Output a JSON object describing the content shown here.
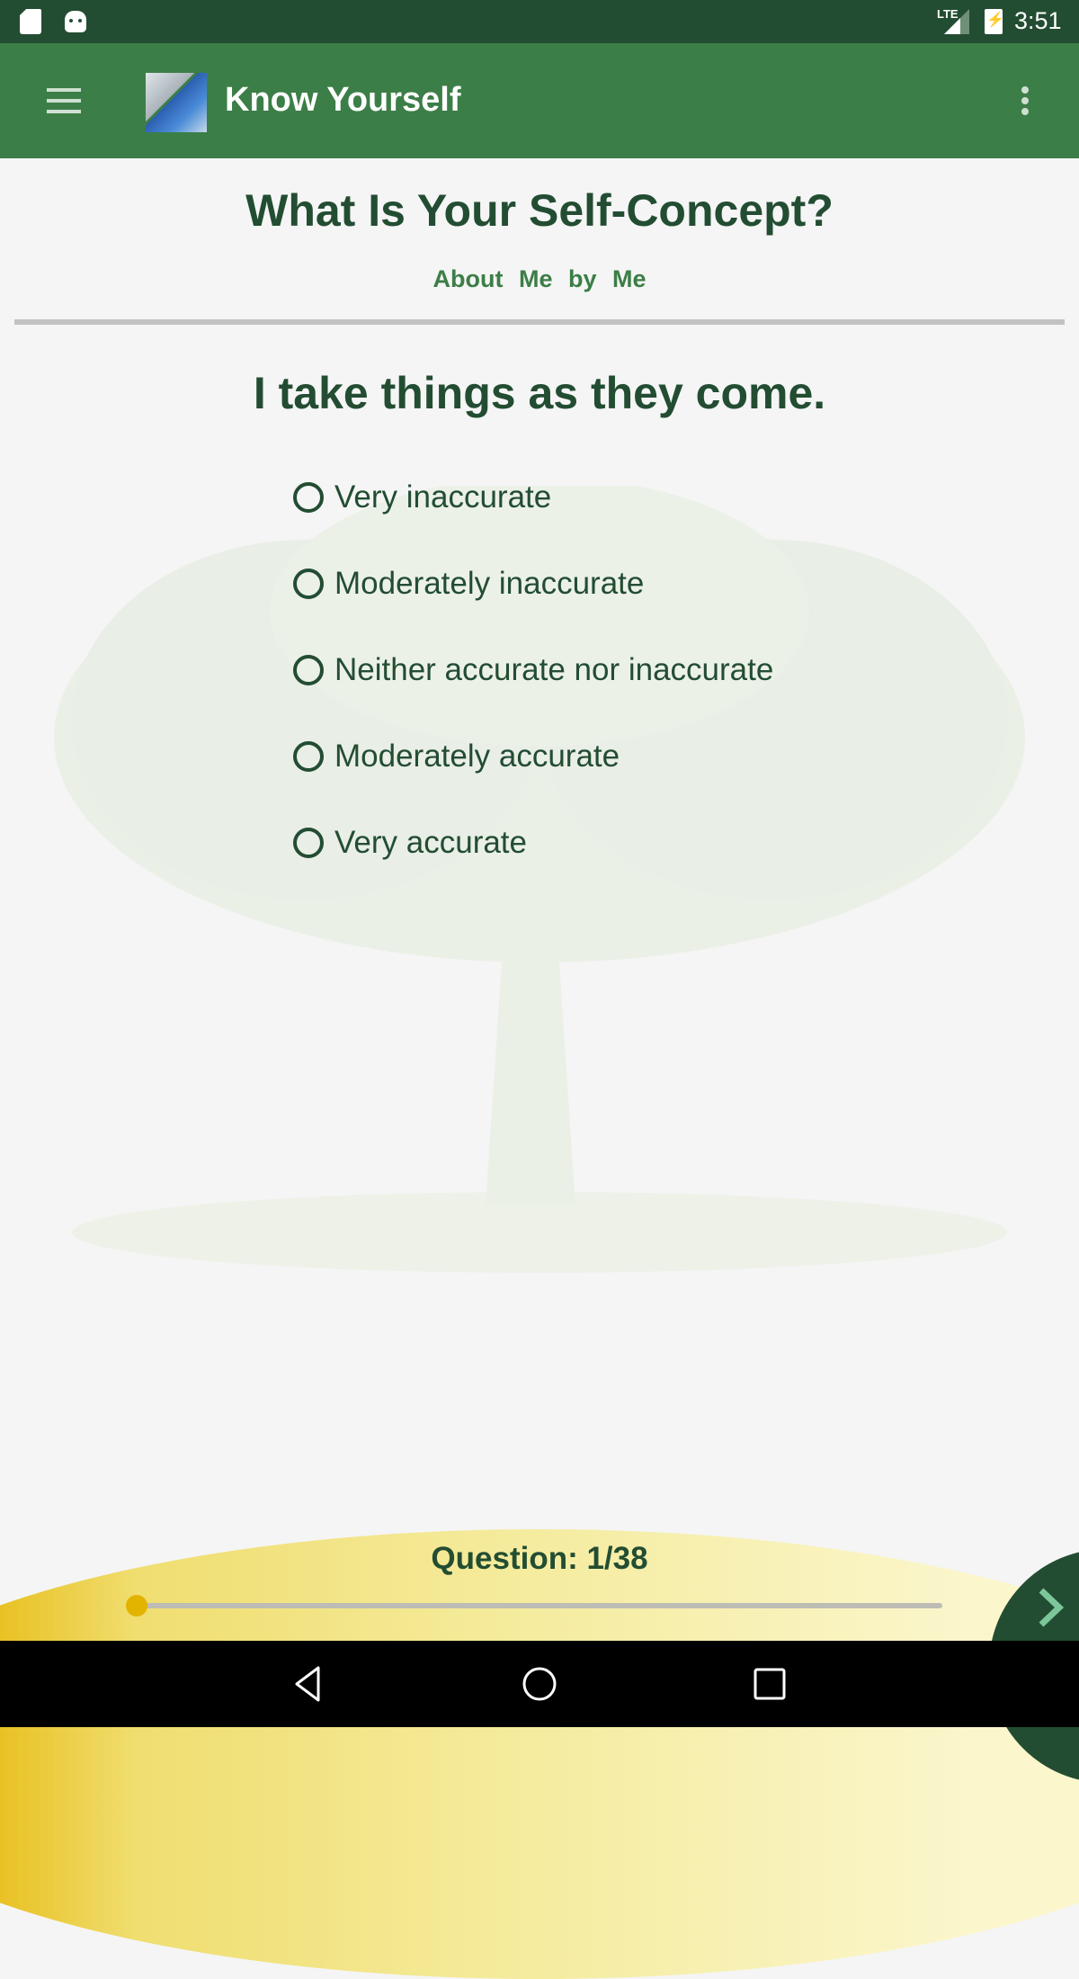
{
  "status_bar": {
    "network_label": "LTE",
    "time": "3:51",
    "icons": [
      "sd-card-icon",
      "android-icon",
      "lte-signal-icon",
      "battery-charging-icon"
    ]
  },
  "app_bar": {
    "title": "Know Yourself",
    "menu_icon": "hamburger-menu-icon",
    "overflow_icon": "more-vert-icon"
  },
  "header": {
    "title": "What Is Your Self-Concept?",
    "subtitle": "About Me by Me"
  },
  "question": {
    "text": "I take things as they come.",
    "options": [
      {
        "label": "Very inaccurate",
        "selected": false
      },
      {
        "label": "Moderately inaccurate",
        "selected": false
      },
      {
        "label": "Neither accurate nor inaccurate",
        "selected": false
      },
      {
        "label": "Moderately accurate",
        "selected": false
      },
      {
        "label": "Very accurate",
        "selected": false
      }
    ]
  },
  "progress": {
    "label": "Question: 1/38",
    "current": 1,
    "total": 38,
    "fraction": 0.0
  },
  "next_button": {
    "icon": "chevron-right-icon"
  },
  "nav_bar": {
    "buttons": [
      "back-icon",
      "home-icon",
      "recents-icon"
    ]
  },
  "colors": {
    "status_bar": "#234d32",
    "app_bar": "#3c7e47",
    "text_dark_green": "#234d32",
    "subtitle_green": "#3c7e47",
    "accent_yellow": "#e2b400",
    "next_chevron": "#7cc79a"
  }
}
